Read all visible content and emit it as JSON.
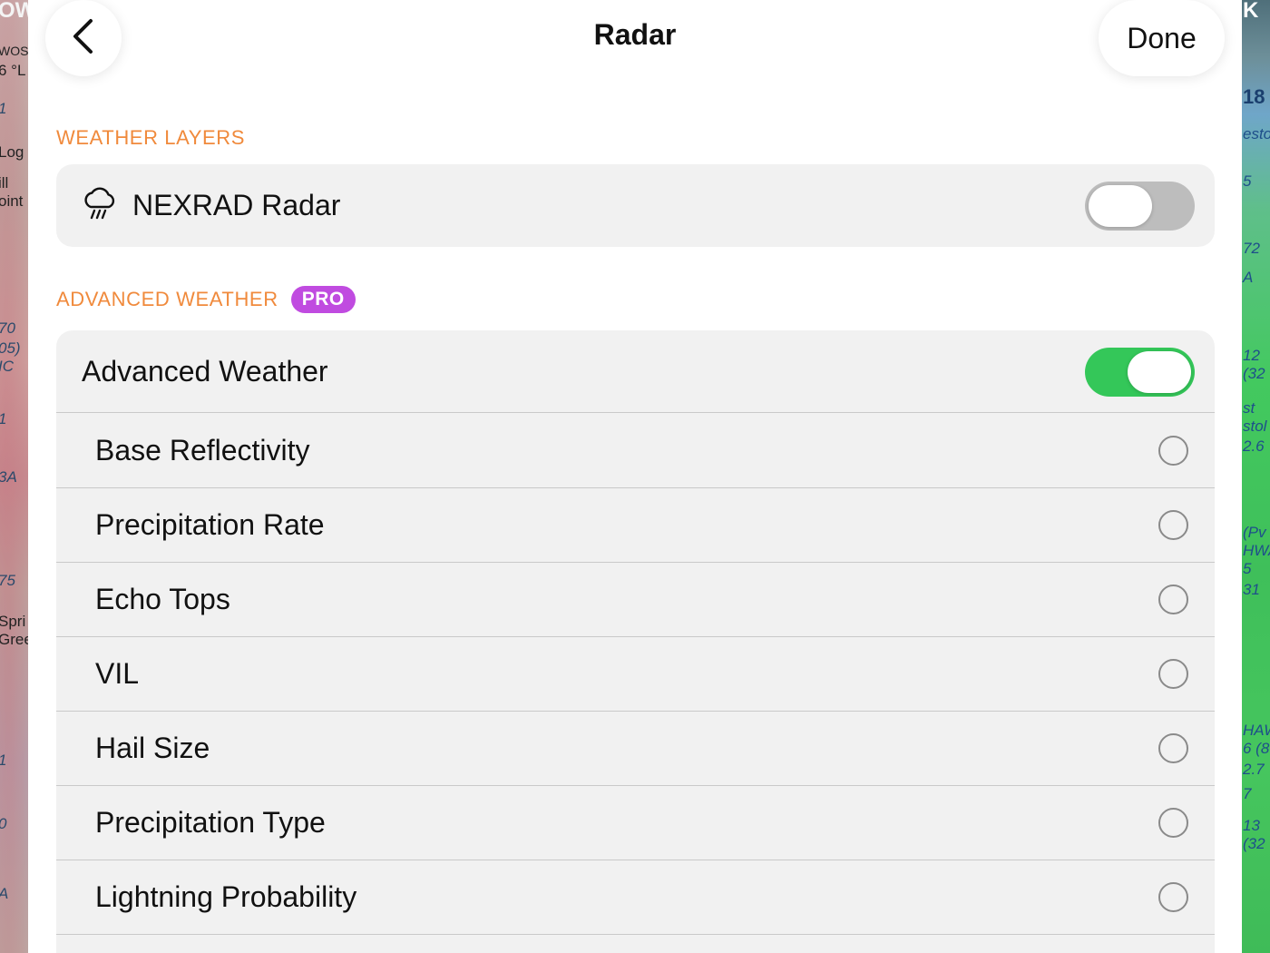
{
  "header": {
    "title": "Radar",
    "done_label": "Done"
  },
  "sections": {
    "weather_layers": {
      "label": "WEATHER LAYERS",
      "items": [
        {
          "label": "NEXRAD Radar",
          "icon": "cloud-rain-icon",
          "toggle": "off"
        }
      ]
    },
    "advanced_weather": {
      "label": "ADVANCED WEATHER",
      "badge": "PRO",
      "master": {
        "label": "Advanced Weather",
        "toggle": "on"
      },
      "options": [
        {
          "label": "Base Reflectivity",
          "selected": false
        },
        {
          "label": "Precipitation Rate",
          "selected": false
        },
        {
          "label": "Echo Tops",
          "selected": false
        },
        {
          "label": "VIL",
          "selected": false
        },
        {
          "label": "Hail Size",
          "selected": false
        },
        {
          "label": "Precipitation Type",
          "selected": false
        },
        {
          "label": "Lightning Probability",
          "selected": false
        }
      ]
    }
  },
  "colors": {
    "section_label": "#f08a3c",
    "pro_badge": "#c04be0",
    "toggle_on": "#34c759",
    "toggle_off": "#bdbdbd",
    "card_bg": "#f1f1f1"
  },
  "background_map": {
    "left_labels": [
      "OW",
      "WOS",
      "6 °L",
      "1",
      "Log",
      "ill",
      "oint",
      "70",
      "05)",
      "IC",
      "1",
      "3A",
      "75",
      "Spri",
      "Gree",
      "1",
      "0",
      "A"
    ],
    "right_labels": [
      "K",
      "18",
      "esto",
      "5",
      "72",
      "A",
      "12",
      "(32",
      "st",
      "stol",
      "2.6",
      "(Pv",
      "HWA",
      "5",
      "31",
      "HAW",
      "6 (8",
      "2.7",
      "7",
      "13",
      "(32"
    ]
  }
}
